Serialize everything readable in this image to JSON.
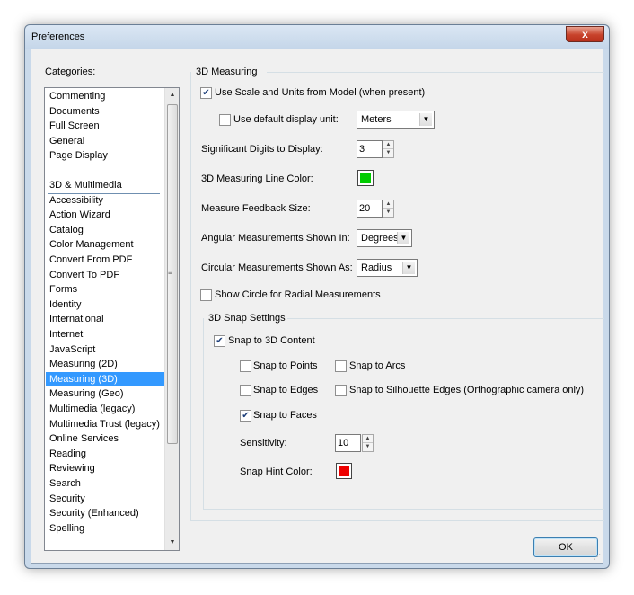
{
  "window": {
    "title": "Preferences",
    "close_glyph": "x"
  },
  "categories": {
    "label": "Categories:",
    "group1": [
      "Commenting",
      "Documents",
      "Full Screen",
      "General",
      "Page Display"
    ],
    "group2": [
      "3D & Multimedia",
      "Accessibility",
      "Action Wizard",
      "Catalog",
      "Color Management",
      "Convert From PDF",
      "Convert To PDF",
      "Forms",
      "Identity",
      "International",
      "Internet",
      "JavaScript",
      "Measuring (2D)",
      "Measuring (3D)",
      "Measuring (Geo)",
      "Multimedia (legacy)",
      "Multimedia Trust (legacy)",
      "Online Services",
      "Reading",
      "Reviewing",
      "Search",
      "Security",
      "Security (Enhanced)",
      "Spelling"
    ],
    "selected": "Measuring (3D)"
  },
  "measuring": {
    "group_title": "3D Measuring",
    "use_scale_label": "Use Scale and Units from Model (when present)",
    "use_scale_checked": true,
    "use_default_unit_label": "Use default display unit:",
    "use_default_unit_checked": false,
    "unit_value": "Meters",
    "sig_digits_label": "Significant Digits to Display:",
    "sig_digits_value": "3",
    "line_color_label": "3D Measuring Line Color:",
    "line_color": "#00cc00",
    "feedback_size_label": "Measure Feedback Size:",
    "feedback_size_value": "20",
    "angular_label": "Angular Measurements Shown In:",
    "angular_value": "Degrees",
    "circular_label": "Circular Measurements Shown As:",
    "circular_value": "Radius",
    "show_circle_label": "Show Circle for Radial Measurements",
    "show_circle_checked": false
  },
  "snap": {
    "group_title": "3D Snap Settings",
    "snap_content_label": "Snap to 3D Content",
    "snap_content_checked": true,
    "points_label": "Snap to Points",
    "points_checked": false,
    "arcs_label": "Snap to Arcs",
    "arcs_checked": false,
    "edges_label": "Snap to Edges",
    "edges_checked": false,
    "silhouette_label": "Snap to Silhouette Edges (Orthographic camera only)",
    "silhouette_checked": false,
    "faces_label": "Snap to Faces",
    "faces_checked": true,
    "sensitivity_label": "Sensitivity:",
    "sensitivity_value": "10",
    "hint_color_label": "Snap Hint Color:",
    "hint_color": "#ee0000"
  },
  "buttons": {
    "ok": "OK"
  },
  "colors": {
    "selection": "#3399ff",
    "window_frame": "#c9d9ea",
    "close_button": "#c8432b"
  }
}
